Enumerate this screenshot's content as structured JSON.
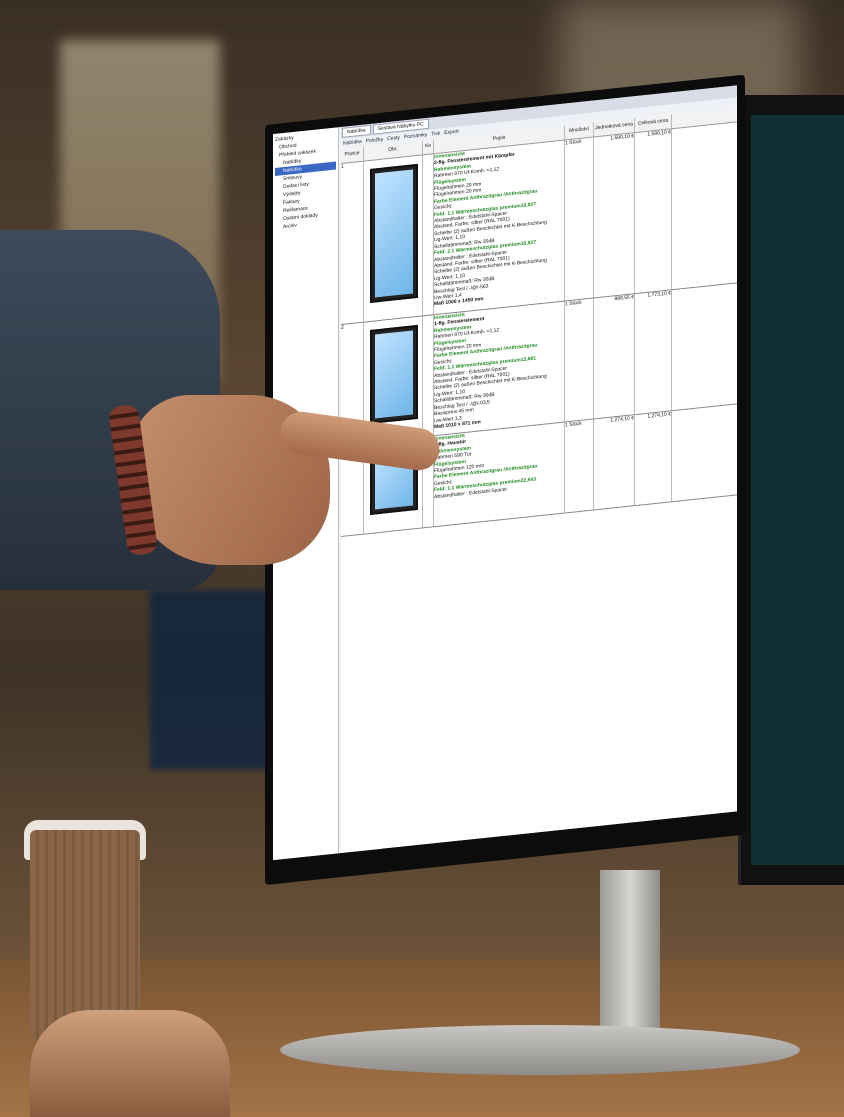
{
  "app": {
    "tabs": [
      "Nabídka",
      "Sestava Nábytku PC"
    ],
    "toolbar": [
      "Nabídka",
      "Položky",
      "Cesty",
      "Poznámky",
      "Tisk",
      "Export"
    ],
    "tree": [
      "Zakázky",
      "Obchod",
      "Přehled zakázek",
      "Nabídky",
      "Nabídka",
      "Smlouvy",
      "Dodací listy",
      "Výdejky",
      "Faktury",
      "Reklamace",
      "Ostatní doklady",
      "Archiv"
    ],
    "tree_selected_index": 4
  },
  "table": {
    "headers": [
      "Pozice",
      "Obr.",
      "Ks",
      "Popis",
      "Množství",
      "Jednotková cena",
      "Celková cena"
    ],
    "rows": [
      {
        "pos": "1",
        "qty": "1 Stück",
        "unit_price": "1.590,10 €",
        "total": "1.590,10 €",
        "desc": [
          {
            "t": "Innenansicht",
            "c": "green"
          },
          {
            "t": "2-flg. Fensterelement mit Kämpfer",
            "c": "bold"
          },
          {
            "t": "Rahmensystem",
            "c": "green"
          },
          {
            "t": "Rahmen 970 Uf-Komb. =1,12",
            "c": ""
          },
          {
            "t": "Flügelsystem",
            "c": "green"
          },
          {
            "t": "Flügelrahmen 20 mm",
            "c": ""
          },
          {
            "t": "Flügelrahmen 20 mm",
            "c": ""
          },
          {
            "t": "Farbe Element Anthrazitgrau /Anthrazitgrau",
            "c": "green"
          },
          {
            "t": "Gesicht:",
            "c": ""
          },
          {
            "t": "Feld: 1.1 Wärmeschutzglas premium10,827",
            "c": "green"
          },
          {
            "t": "Abstandhalter : Edelstahl-Spacer",
            "c": ""
          },
          {
            "t": "Abstand. Farbe: silber (RAL 7001)",
            "c": ""
          },
          {
            "t": "Scheibe (2) außen Beschichtet mit K-Beschichtung",
            "c": ""
          },
          {
            "t": "Ug-Wert: 1,10",
            "c": ""
          },
          {
            "t": "Schalldämmmaß: Rw 30dB",
            "c": ""
          },
          {
            "t": "Feld: 2.1 Wärmeschutzglas premium10,827",
            "c": "green"
          },
          {
            "t": "Abstandhalter : Edelstahl-Spacer",
            "c": ""
          },
          {
            "t": "Abstand. Farbe: silber (RAL 7001)",
            "c": ""
          },
          {
            "t": "Scheibe (2) außen Beschichtet mit K-Beschichtung",
            "c": ""
          },
          {
            "t": "Ug-Wert: 1,10",
            "c": ""
          },
          {
            "t": "Schalldämmmaß: Rw 30dB",
            "c": ""
          },
          {
            "t": "Beschlag      Tesl / -/@/-563",
            "c": ""
          },
          {
            "t": "Uw-Wert       1,4",
            "c": ""
          },
          {
            "t": "Maß           1000 x 1450 mm",
            "c": "bold"
          }
        ]
      },
      {
        "pos": "2",
        "qty": "1 Stück",
        "unit_price": "886,55 €",
        "total": "1.773,10 €",
        "desc": [
          {
            "t": "Innenansicht",
            "c": "green"
          },
          {
            "t": "1-flg. Fensterelement",
            "c": "bold"
          },
          {
            "t": "Rahmensystem",
            "c": "green"
          },
          {
            "t": "Rahmen 970 Uf-Komb. =1,12",
            "c": ""
          },
          {
            "t": "Flügelsystem",
            "c": "green"
          },
          {
            "t": "Flügelrahmen 20 mm",
            "c": ""
          },
          {
            "t": "Farbe Element Anthrazitgrau /Anthrazitgrau",
            "c": "green"
          },
          {
            "t": "Gesicht:",
            "c": ""
          },
          {
            "t": "Feld: 1.1 Wärmeschutzglas premium12,681",
            "c": "green"
          },
          {
            "t": "Abstandhalter : Edelstahl-Spacer",
            "c": ""
          },
          {
            "t": "Abstand. Farbe: silber (RAL 7001)",
            "c": ""
          },
          {
            "t": "Scheibe (2) außen Beschichtet mit K-Beschichtung",
            "c": ""
          },
          {
            "t": "Ug-Wert: 1,10",
            "c": ""
          },
          {
            "t": "Schalldämmmaß: Rw 30dB",
            "c": ""
          },
          {
            "t": "Beschlag      Tesl / -/@/-03,5",
            "c": ""
          },
          {
            "t": "              Basispreis 45 mm",
            "c": ""
          },
          {
            "t": "Uw-Wert       1,3",
            "c": ""
          },
          {
            "t": "Maß           1010 x 871 mm",
            "c": "bold"
          }
        ]
      },
      {
        "pos": "3",
        "qty": "1 Stück",
        "unit_price": "1.274,10 €",
        "total": "1.274,10 €",
        "desc": [
          {
            "t": "Innenansicht",
            "c": "green"
          },
          {
            "t": "1-flg. Haustür",
            "c": "bold"
          },
          {
            "t": "Rahmensystem",
            "c": "green"
          },
          {
            "t": "Rahmen 590 Tür",
            "c": ""
          },
          {
            "t": "Flügelsystem",
            "c": "green"
          },
          {
            "t": "Flügelrahmen 120 mm",
            "c": ""
          },
          {
            "t": "Farbe Element Anthrazitgrau /Anthrazitgrau",
            "c": "green"
          },
          {
            "t": "Gesicht:",
            "c": ""
          },
          {
            "t": "Feld: 1.1 Wärmeschutzglas premium22,543",
            "c": "green"
          },
          {
            "t": "Abstandhalter : Edelstahl-Spacer",
            "c": ""
          }
        ]
      }
    ]
  }
}
